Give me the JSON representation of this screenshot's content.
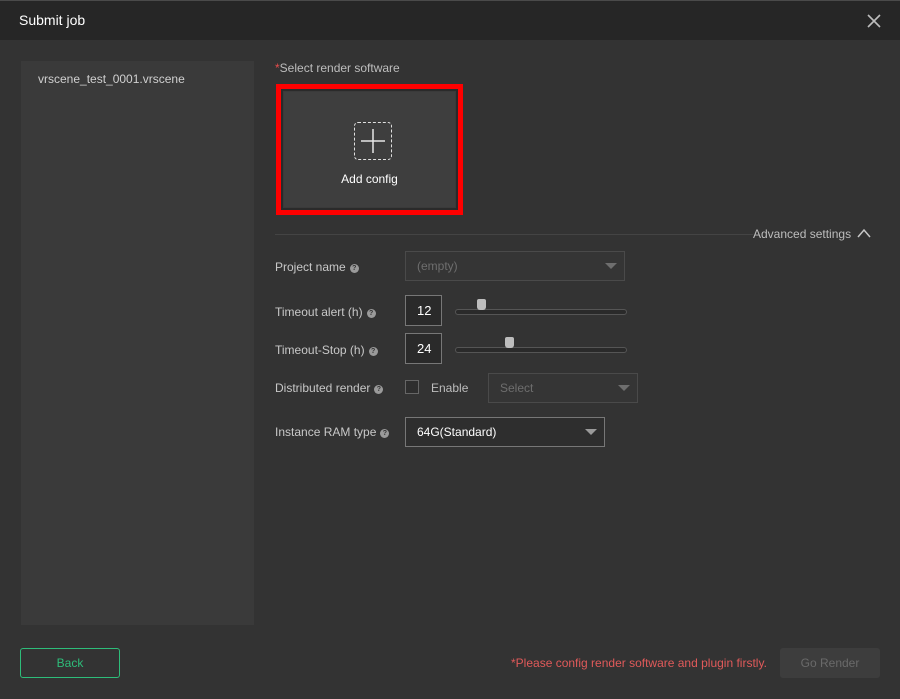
{
  "window": {
    "title": "Submit job"
  },
  "files": [
    {
      "name": "vrscene_test_0001.vrscene"
    }
  ],
  "render_software": {
    "required_mark": "*",
    "label": "Select render software",
    "add_config_label": "Add config"
  },
  "advanced": {
    "label": "Advanced settings"
  },
  "project_name": {
    "label": "Project name",
    "value": "(empty)"
  },
  "timeout_alert": {
    "label": "Timeout alert (h)",
    "value": "12",
    "slider_fraction": 0.15
  },
  "timeout_stop": {
    "label": "Timeout-Stop (h)",
    "value": "24",
    "slider_fraction": 0.32
  },
  "distributed_render": {
    "label": "Distributed render",
    "checkbox_label": "Enable",
    "select_placeholder": "Select"
  },
  "instance_ram": {
    "label": "Instance RAM type",
    "value": "64G(Standard)"
  },
  "footer": {
    "back_label": "Back",
    "warning": "*Please config render software and plugin firstly.",
    "go_label": "Go Render"
  },
  "colors": {
    "accent": "#2ebd7a",
    "warning": "#e05a5a",
    "highlight_border": "#ff0000"
  }
}
